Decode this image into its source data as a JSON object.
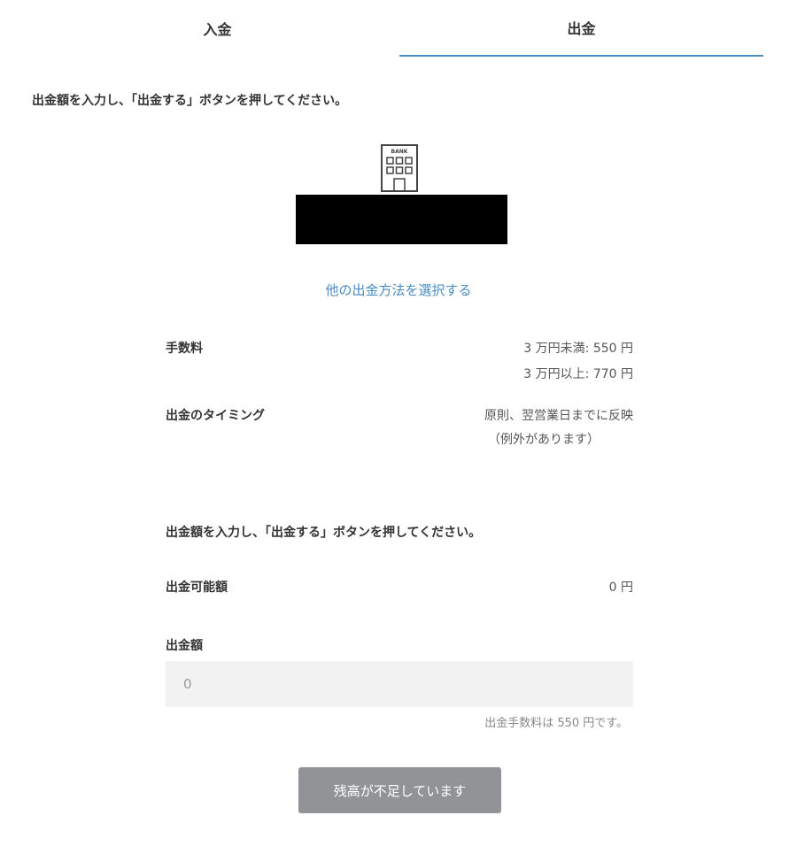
{
  "tabs": {
    "deposit_label": "入金",
    "withdraw_label": "出金"
  },
  "instruction_top": "出金額を入力し、「出金する」ボタンを押してください。",
  "bank": {
    "icon_name": "bank-building-icon",
    "icon_text": "BANK"
  },
  "other_method_link": "他の出金方法を選択する",
  "fee": {
    "label": "手数料",
    "line1": "3 万円未満: 550 円",
    "line2": "3 万円以上: 770 円"
  },
  "timing": {
    "label": "出金のタイミング",
    "line1": "原則、翌営業日までに反映",
    "line2": "（例外があります）"
  },
  "instruction_mid": "出金額を入力し、「出金する」ボタンを押してください。",
  "available": {
    "label": "出金可能額",
    "value": "0 円"
  },
  "amount": {
    "label": "出金額",
    "placeholder": "0",
    "fee_note": "出金手数料は 550 円です。"
  },
  "submit_button": {
    "label": "残高が不足しています",
    "color": "#919397"
  },
  "colors": {
    "accent": "#4a8bc2"
  }
}
